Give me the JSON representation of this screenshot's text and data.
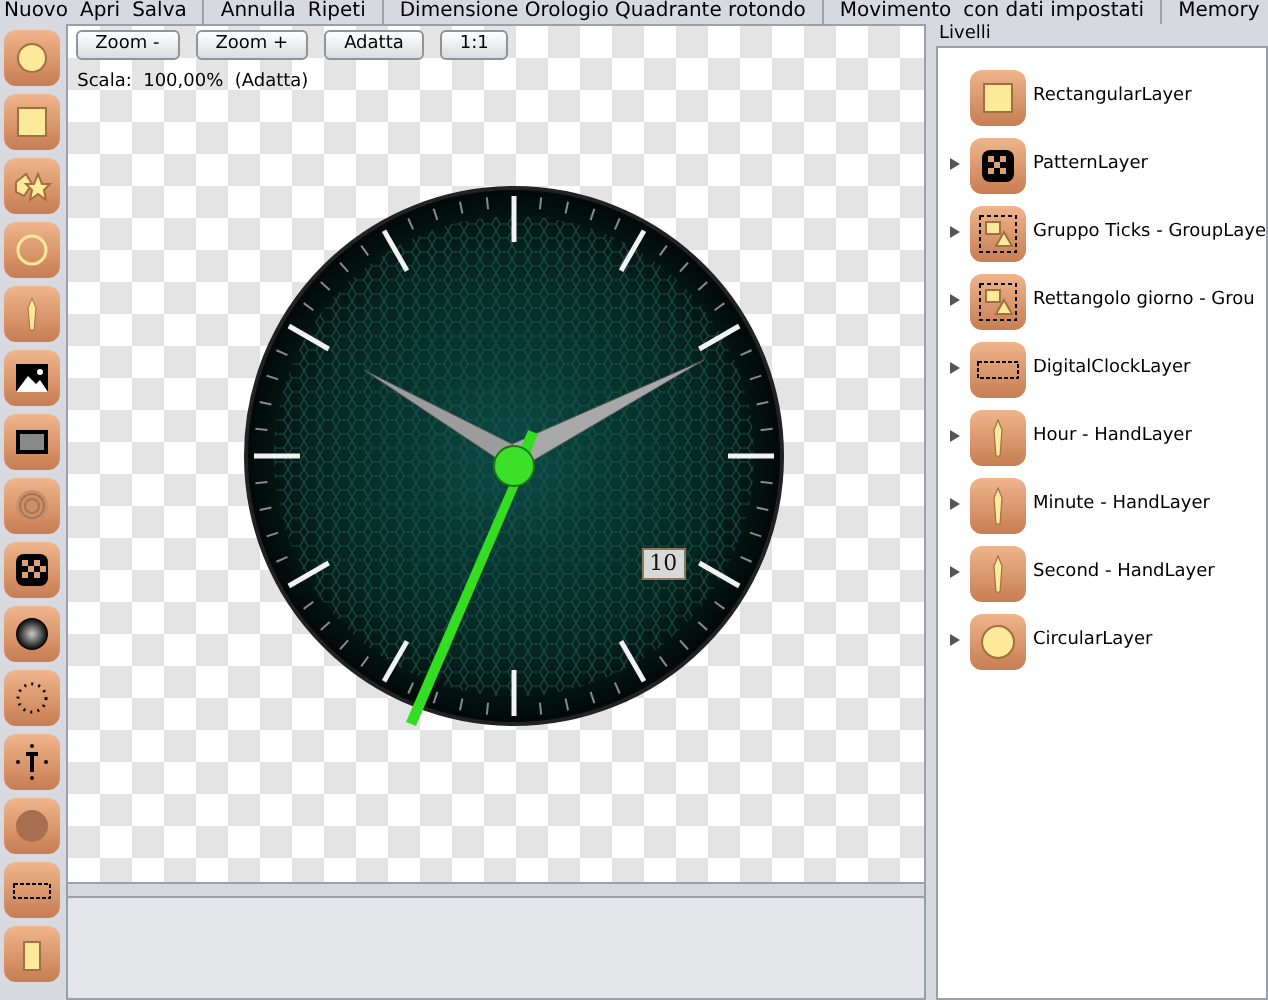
{
  "menu_bar": [
    [
      "Nuovo",
      "Apri",
      "Salva"
    ],
    [
      "Annulla",
      "Ripeti"
    ],
    [
      "Dimensione Orologio Quadrante rotondo"
    ],
    [
      "Movimento",
      "con dati impostati"
    ],
    [
      "Memory"
    ]
  ],
  "zoom_buttons": [
    "Zoom -",
    "Zoom +",
    "Adatta",
    "1:1"
  ],
  "scale_label": "Scala:  100,00%  (Adatta)",
  "clock": {
    "date": "10"
  },
  "layers_panel": {
    "title": "Livelli",
    "items": [
      {
        "label": "RectangularLayer",
        "kind": "rect",
        "expandable": false
      },
      {
        "label": "PatternLayer",
        "kind": "pattern",
        "expandable": true
      },
      {
        "label": "Gruppo Ticks - GroupLaye",
        "kind": "group",
        "expandable": true
      },
      {
        "label": "Rettangolo giorno - Grou",
        "kind": "group",
        "expandable": true
      },
      {
        "label": "DigitalClockLayer",
        "kind": "digital",
        "expandable": true
      },
      {
        "label": "Hour - HandLayer",
        "kind": "hand",
        "expandable": true
      },
      {
        "label": "Minute - HandLayer",
        "kind": "hand",
        "expandable": true
      },
      {
        "label": "Second - HandLayer",
        "kind": "hand",
        "expandable": true
      },
      {
        "label": "CircularLayer",
        "kind": "circle",
        "expandable": true
      }
    ]
  }
}
